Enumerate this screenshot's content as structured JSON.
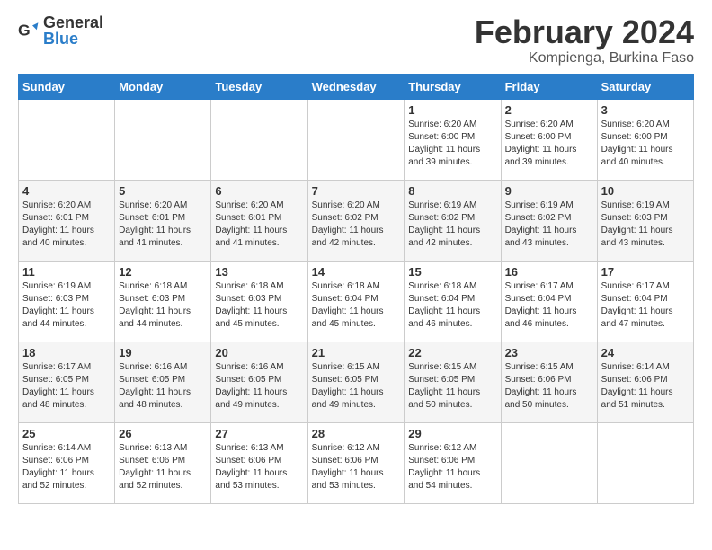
{
  "header": {
    "logo_general": "General",
    "logo_blue": "Blue",
    "title": "February 2024",
    "subtitle": "Kompienga, Burkina Faso"
  },
  "columns": [
    "Sunday",
    "Monday",
    "Tuesday",
    "Wednesday",
    "Thursday",
    "Friday",
    "Saturday"
  ],
  "weeks": [
    [
      {
        "day": "",
        "info": ""
      },
      {
        "day": "",
        "info": ""
      },
      {
        "day": "",
        "info": ""
      },
      {
        "day": "",
        "info": ""
      },
      {
        "day": "1",
        "info": "Sunrise: 6:20 AM\nSunset: 6:00 PM\nDaylight: 11 hours\nand 39 minutes."
      },
      {
        "day": "2",
        "info": "Sunrise: 6:20 AM\nSunset: 6:00 PM\nDaylight: 11 hours\nand 39 minutes."
      },
      {
        "day": "3",
        "info": "Sunrise: 6:20 AM\nSunset: 6:00 PM\nDaylight: 11 hours\nand 40 minutes."
      }
    ],
    [
      {
        "day": "4",
        "info": "Sunrise: 6:20 AM\nSunset: 6:01 PM\nDaylight: 11 hours\nand 40 minutes."
      },
      {
        "day": "5",
        "info": "Sunrise: 6:20 AM\nSunset: 6:01 PM\nDaylight: 11 hours\nand 41 minutes."
      },
      {
        "day": "6",
        "info": "Sunrise: 6:20 AM\nSunset: 6:01 PM\nDaylight: 11 hours\nand 41 minutes."
      },
      {
        "day": "7",
        "info": "Sunrise: 6:20 AM\nSunset: 6:02 PM\nDaylight: 11 hours\nand 42 minutes."
      },
      {
        "day": "8",
        "info": "Sunrise: 6:19 AM\nSunset: 6:02 PM\nDaylight: 11 hours\nand 42 minutes."
      },
      {
        "day": "9",
        "info": "Sunrise: 6:19 AM\nSunset: 6:02 PM\nDaylight: 11 hours\nand 43 minutes."
      },
      {
        "day": "10",
        "info": "Sunrise: 6:19 AM\nSunset: 6:03 PM\nDaylight: 11 hours\nand 43 minutes."
      }
    ],
    [
      {
        "day": "11",
        "info": "Sunrise: 6:19 AM\nSunset: 6:03 PM\nDaylight: 11 hours\nand 44 minutes."
      },
      {
        "day": "12",
        "info": "Sunrise: 6:18 AM\nSunset: 6:03 PM\nDaylight: 11 hours\nand 44 minutes."
      },
      {
        "day": "13",
        "info": "Sunrise: 6:18 AM\nSunset: 6:03 PM\nDaylight: 11 hours\nand 45 minutes."
      },
      {
        "day": "14",
        "info": "Sunrise: 6:18 AM\nSunset: 6:04 PM\nDaylight: 11 hours\nand 45 minutes."
      },
      {
        "day": "15",
        "info": "Sunrise: 6:18 AM\nSunset: 6:04 PM\nDaylight: 11 hours\nand 46 minutes."
      },
      {
        "day": "16",
        "info": "Sunrise: 6:17 AM\nSunset: 6:04 PM\nDaylight: 11 hours\nand 46 minutes."
      },
      {
        "day": "17",
        "info": "Sunrise: 6:17 AM\nSunset: 6:04 PM\nDaylight: 11 hours\nand 47 minutes."
      }
    ],
    [
      {
        "day": "18",
        "info": "Sunrise: 6:17 AM\nSunset: 6:05 PM\nDaylight: 11 hours\nand 48 minutes."
      },
      {
        "day": "19",
        "info": "Sunrise: 6:16 AM\nSunset: 6:05 PM\nDaylight: 11 hours\nand 48 minutes."
      },
      {
        "day": "20",
        "info": "Sunrise: 6:16 AM\nSunset: 6:05 PM\nDaylight: 11 hours\nand 49 minutes."
      },
      {
        "day": "21",
        "info": "Sunrise: 6:15 AM\nSunset: 6:05 PM\nDaylight: 11 hours\nand 49 minutes."
      },
      {
        "day": "22",
        "info": "Sunrise: 6:15 AM\nSunset: 6:05 PM\nDaylight: 11 hours\nand 50 minutes."
      },
      {
        "day": "23",
        "info": "Sunrise: 6:15 AM\nSunset: 6:06 PM\nDaylight: 11 hours\nand 50 minutes."
      },
      {
        "day": "24",
        "info": "Sunrise: 6:14 AM\nSunset: 6:06 PM\nDaylight: 11 hours\nand 51 minutes."
      }
    ],
    [
      {
        "day": "25",
        "info": "Sunrise: 6:14 AM\nSunset: 6:06 PM\nDaylight: 11 hours\nand 52 minutes."
      },
      {
        "day": "26",
        "info": "Sunrise: 6:13 AM\nSunset: 6:06 PM\nDaylight: 11 hours\nand 52 minutes."
      },
      {
        "day": "27",
        "info": "Sunrise: 6:13 AM\nSunset: 6:06 PM\nDaylight: 11 hours\nand 53 minutes."
      },
      {
        "day": "28",
        "info": "Sunrise: 6:12 AM\nSunset: 6:06 PM\nDaylight: 11 hours\nand 53 minutes."
      },
      {
        "day": "29",
        "info": "Sunrise: 6:12 AM\nSunset: 6:06 PM\nDaylight: 11 hours\nand 54 minutes."
      },
      {
        "day": "",
        "info": ""
      },
      {
        "day": "",
        "info": ""
      }
    ]
  ]
}
